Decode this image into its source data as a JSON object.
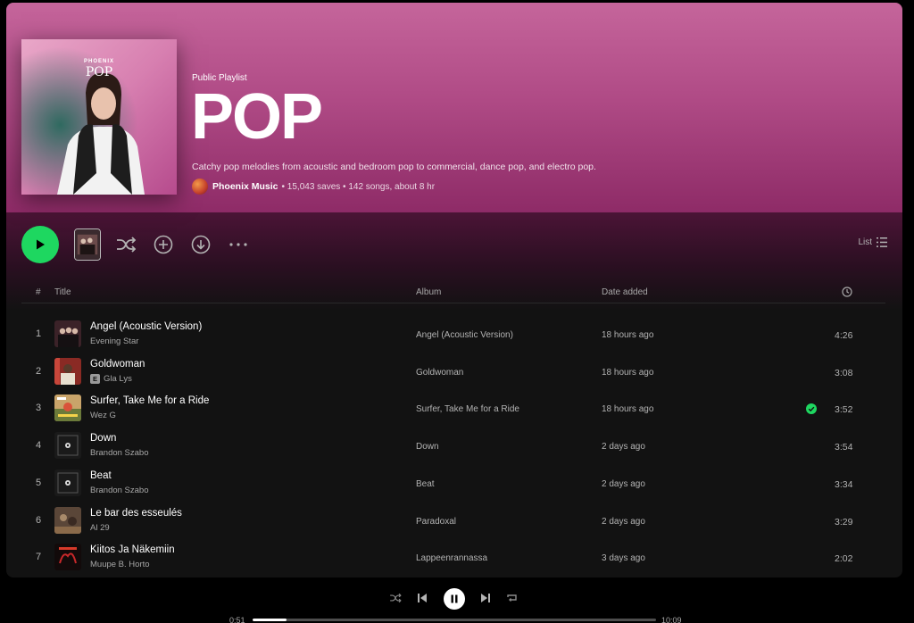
{
  "playlist": {
    "type_label": "Public Playlist",
    "title": "POP",
    "description": "Catchy pop melodies from acoustic and bedroom pop to commercial, dance pop, and electro pop.",
    "owner": "Phoenix Music",
    "meta": "• 15,043 saves • 142 songs, about 8 hr",
    "cover_brand": "PHOENIX",
    "cover_title": "POP"
  },
  "controls": {
    "view_label": "List",
    "icons": [
      "play-icon",
      "shuffle-icon",
      "add-circle-icon",
      "download-icon",
      "more-icon",
      "list-icon"
    ]
  },
  "table": {
    "headers": {
      "num": "#",
      "title": "Title",
      "album": "Album",
      "date_added": "Date added"
    },
    "tracks": [
      {
        "num": "1",
        "title": "Angel (Acoustic Version)",
        "artist": "Evening Star",
        "explicit": false,
        "album": "Angel (Acoustic Version)",
        "date_added": "18 hours ago",
        "duration": "4:26",
        "saved": false
      },
      {
        "num": "2",
        "title": "Goldwoman",
        "artist": "Gla Lys",
        "explicit": true,
        "album": "Goldwoman",
        "date_added": "18 hours ago",
        "duration": "3:08",
        "saved": false
      },
      {
        "num": "3",
        "title": "Surfer, Take Me for a Ride",
        "artist": "Wez G",
        "explicit": false,
        "album": "Surfer, Take Me for a Ride",
        "date_added": "18 hours ago",
        "duration": "3:52",
        "saved": true
      },
      {
        "num": "4",
        "title": "Down",
        "artist": "Brandon Szabo",
        "explicit": false,
        "album": "Down",
        "date_added": "2 days ago",
        "duration": "3:54",
        "saved": false
      },
      {
        "num": "5",
        "title": "Beat",
        "artist": "Brandon Szabo",
        "explicit": false,
        "album": "Beat",
        "date_added": "2 days ago",
        "duration": "3:34",
        "saved": false
      },
      {
        "num": "6",
        "title": "Le bar des esseulés",
        "artist": "Al 29",
        "explicit": false,
        "album": "Paradoxal",
        "date_added": "2 days ago",
        "duration": "3:29",
        "saved": false
      },
      {
        "num": "7",
        "title": "Kiitos Ja Näkemiin",
        "artist": "Muupe B. Horto",
        "explicit": false,
        "album": "Lappeenrannassa",
        "date_added": "3 days ago",
        "duration": "2:02",
        "saved": false
      }
    ]
  },
  "player": {
    "elapsed": "0:51",
    "total": "10:09",
    "progress_fraction": 0.084
  },
  "colors": {
    "accent": "#1ed760",
    "hero_top": "#c5659b",
    "hero_bottom": "#8e2b67",
    "background": "#121212"
  }
}
